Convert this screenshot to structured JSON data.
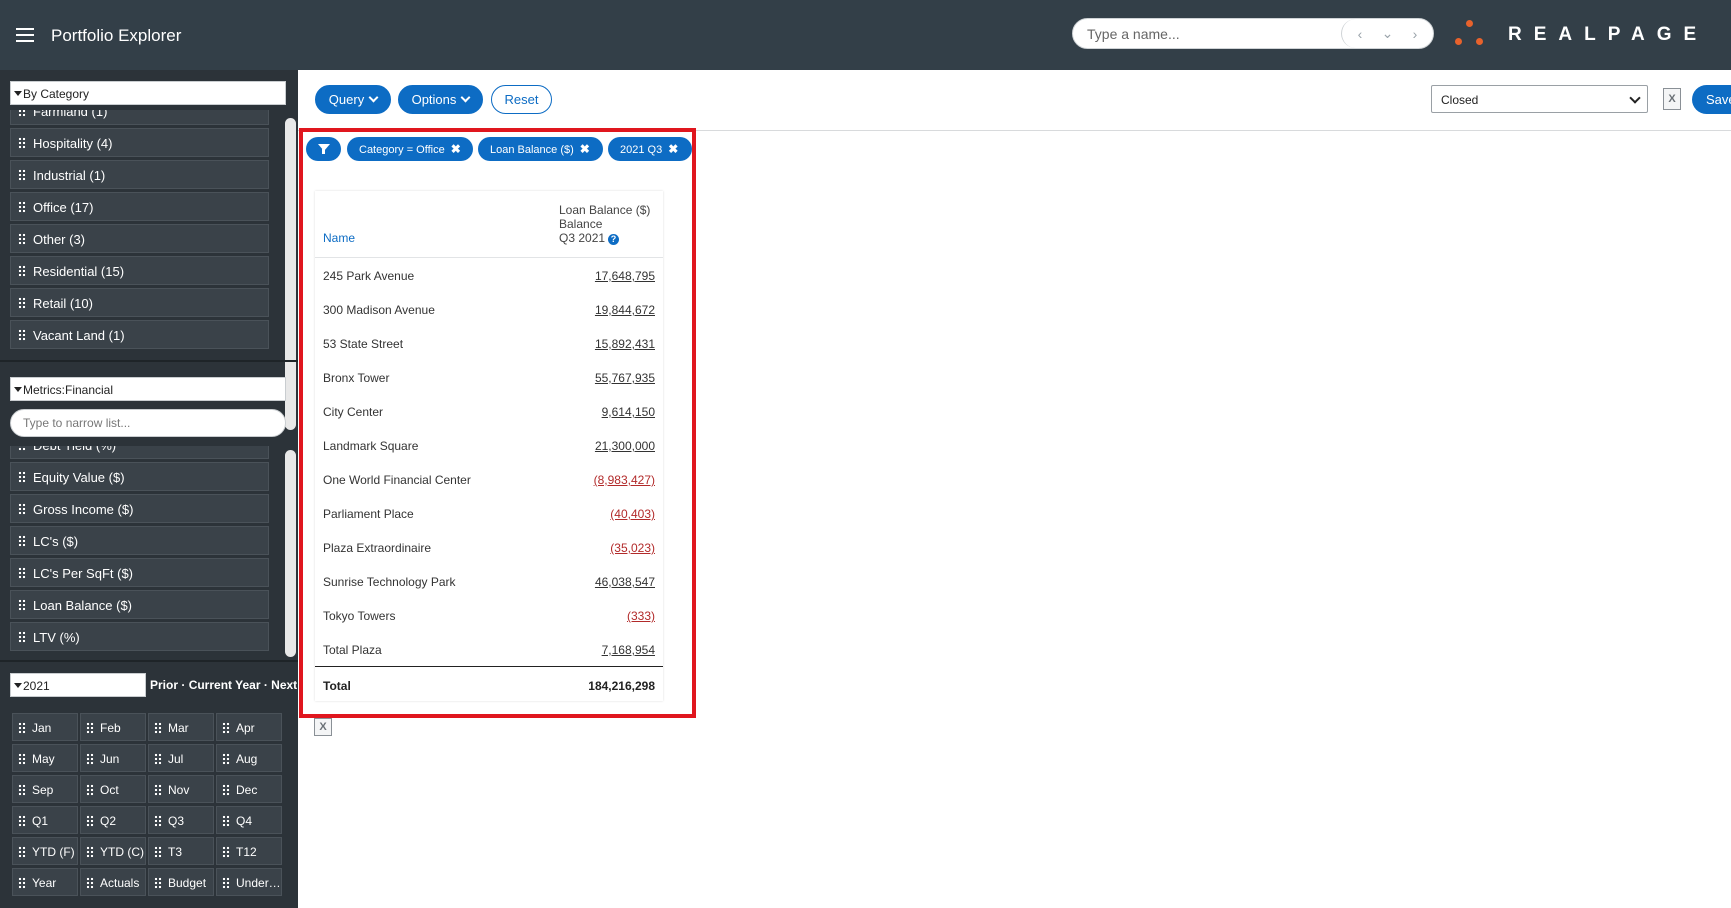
{
  "header": {
    "title": "Portfolio Explorer",
    "search_placeholder": "Type a name...",
    "nav_prev": "‹",
    "nav_down": "⌄",
    "nav_next": "›",
    "logo_text": "REALPAGE",
    "accent_color": "#e8622c"
  },
  "sidebar": {
    "category_select": "By Category",
    "category_items": [
      "Farmland (1)",
      "Hospitality (4)",
      "Industrial (1)",
      "Office (17)",
      "Other (3)",
      "Residential (15)",
      "Retail (10)",
      "Vacant Land (1)"
    ],
    "metrics_select": "Metrics:Financial",
    "narrow_placeholder": "Type to narrow list...",
    "metric_items": [
      "Debt Yield (%)",
      "Equity Value ($)",
      "Gross Income ($)",
      "LC's ($)",
      "LC's Per SqFt ($)",
      "Loan Balance ($)",
      "LTV (%)"
    ],
    "year_select": "2021",
    "year_links": {
      "prior": "Prior",
      "current": "Current Year",
      "next": "Next",
      "sep": " · "
    },
    "periods": [
      "Jan",
      "Feb",
      "Mar",
      "Apr",
      "May",
      "Jun",
      "Jul",
      "Aug",
      "Sep",
      "Oct",
      "Nov",
      "Dec",
      "Q1",
      "Q2",
      "Q3",
      "Q4",
      "YTD (F)",
      "YTD (C)",
      "T3",
      "T12",
      "Year",
      "Actuals",
      "Budget",
      "Under…"
    ]
  },
  "toolbar": {
    "query_label": "Query",
    "options_label": "Options",
    "reset_label": "Reset",
    "status_select": "Closed",
    "excel_label": "X",
    "save_label": "Save"
  },
  "filters": {
    "chips": [
      "Category = Office",
      "Loan Balance ($)",
      "2021 Q3"
    ],
    "remove_glyph": "✖"
  },
  "report": {
    "name_header": "Name",
    "metric_header_line1": "Loan Balance ($)",
    "metric_header_line2": "Balance",
    "metric_header_line3": "Q3 2021",
    "help_glyph": "?",
    "rows": [
      {
        "name": "245 Park Avenue",
        "value": "17,648,795",
        "negative": false
      },
      {
        "name": "300 Madison Avenue",
        "value": "19,844,672",
        "negative": false
      },
      {
        "name": "53 State Street",
        "value": "15,892,431",
        "negative": false
      },
      {
        "name": "Bronx Tower",
        "value": "55,767,935",
        "negative": false
      },
      {
        "name": "City Center",
        "value": "9,614,150",
        "negative": false
      },
      {
        "name": "Landmark Square",
        "value": "21,300,000",
        "negative": false
      },
      {
        "name": "One World Financial Center",
        "value": "(8,983,427)",
        "negative": true
      },
      {
        "name": "Parliament Place",
        "value": "(40,403)",
        "negative": true
      },
      {
        "name": "Plaza Extraordinaire",
        "value": "(35,023)",
        "negative": true
      },
      {
        "name": "Sunrise Technology Park",
        "value": "46,038,547",
        "negative": false
      },
      {
        "name": "Tokyo Towers",
        "value": "(333)",
        "negative": true
      },
      {
        "name": "Total Plaza",
        "value": "7,168,954",
        "negative": false
      }
    ],
    "total_label": "Total",
    "total_value": "184,216,298"
  }
}
